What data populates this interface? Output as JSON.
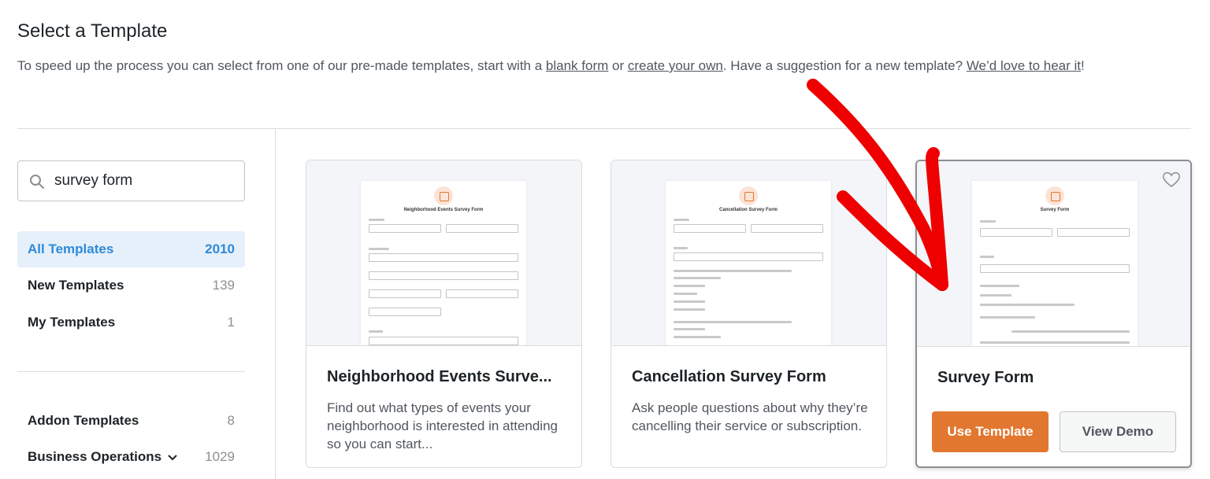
{
  "header": {
    "title": "Select a Template",
    "desc_before": "To speed up the process you can select from one of our pre-made templates, start with a ",
    "blank_form_link": "blank form",
    "desc_or": " or ",
    "create_own_link": "create your own",
    "desc_middle": ". Have a suggestion for a new template? ",
    "love_to_hear_link": "We’d love to hear it",
    "desc_end": "!"
  },
  "search": {
    "value": "survey form"
  },
  "sidebar": {
    "categories": [
      {
        "label": "All Templates",
        "count": "2010"
      },
      {
        "label": "New Templates",
        "count": "139"
      },
      {
        "label": "My Templates",
        "count": "1"
      },
      {
        "label": "Addon Templates",
        "count": "8"
      },
      {
        "label": "Business Operations",
        "count": "1029"
      }
    ]
  },
  "cards": [
    {
      "title": "Neighborhood Events Surve...",
      "description": "Find out what types of events your neighborhood is interested in attending so you can start...",
      "preview_title": "Neighborhood Events Survey Form"
    },
    {
      "title": "Cancellation Survey Form",
      "description": "Ask people questions about why they’re cancelling their service or subscription.",
      "preview_title": "Cancellation Survey Form"
    },
    {
      "title": "Survey Form",
      "preview_title": "Survey Form",
      "use_label": "Use Template",
      "demo_label": "View Demo"
    }
  ],
  "colors": {
    "accent": "#e27730",
    "active": "#2e8ad8",
    "arrow": "#ee0000"
  }
}
